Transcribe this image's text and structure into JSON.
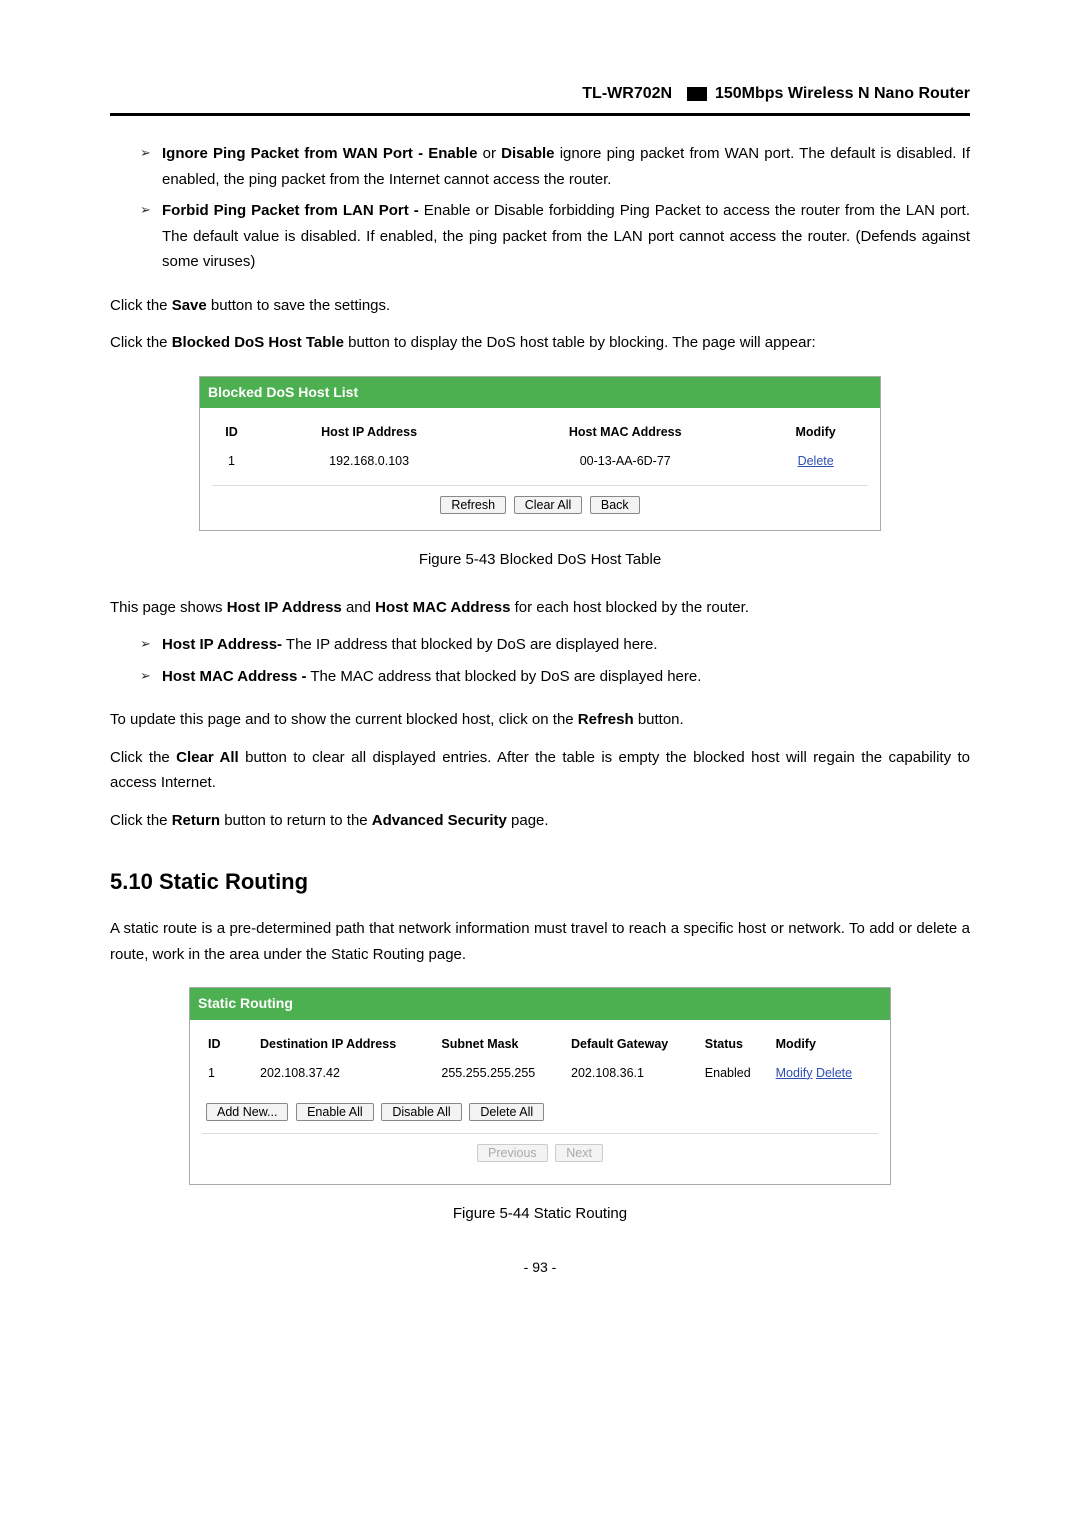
{
  "header": {
    "model": "TL-WR702N",
    "desc": "150Mbps Wireless N Nano Router"
  },
  "bullets_top": [
    {
      "bold": "Ignore Ping Packet from WAN Port - Enable",
      "mid": " or ",
      "bold2": "Disable",
      "rest": " ignore ping packet from WAN port. The default is disabled. If enabled, the ping packet from the Internet cannot access the router."
    },
    {
      "bold": "Forbid Ping Packet from LAN Port -",
      "rest": " Enable or Disable forbidding Ping Packet to access the router from the LAN port. The default value is disabled. If enabled, the ping packet from the LAN port cannot access the router. (Defends against some viruses)"
    }
  ],
  "para_save": {
    "pre": "Click the ",
    "bold": "Save",
    "post": " button to save the settings."
  },
  "para_blocked": {
    "pre": "Click the ",
    "bold": "Blocked DoS Host Table",
    "post": " button to display the DoS host table by blocking. The page will appear:"
  },
  "fig1": {
    "title": "Blocked DoS Host List",
    "headers": {
      "id": "ID",
      "ip": "Host IP Address",
      "mac": "Host MAC Address",
      "mod": "Modify"
    },
    "row": {
      "id": "1",
      "ip": "192.168.0.103",
      "mac": "00-13-AA-6D-77",
      "mod": "Delete"
    },
    "buttons": {
      "refresh": "Refresh",
      "clear": "Clear All",
      "back": "Back"
    },
    "caption": "Figure 5-43 Blocked DoS Host Table"
  },
  "para_shows": {
    "pre": "This page shows ",
    "b1": "Host IP Address",
    "mid": " and ",
    "b2": "Host MAC Address",
    "post": " for each host blocked by the router."
  },
  "bullets_mid": [
    {
      "bold": "Host IP Address-",
      "rest": " The IP address that blocked by DoS are displayed here."
    },
    {
      "bold": "Host MAC Address -",
      "rest": " The MAC address that blocked by DoS are displayed here."
    }
  ],
  "para_refresh": {
    "pre": "To update this page and to show the current blocked host, click on the ",
    "bold": "Refresh",
    "post": " button."
  },
  "para_clear": {
    "pre": "Click the ",
    "bold": "Clear All",
    "post": " button to clear all displayed entries. After the table is empty the blocked host will regain the capability to access Internet."
  },
  "para_return": {
    "pre": "Click the ",
    "bold": "Return",
    "mid": " button to return to the ",
    "bold2": "Advanced Security",
    "post": " page."
  },
  "section": {
    "num": "5.10",
    "title": "Static Routing"
  },
  "para_static": "A static route is a pre-determined path that network information must travel to reach a specific host or network. To add or delete a route, work in the area under the Static Routing page.",
  "fig2": {
    "title": "Static Routing",
    "headers": {
      "id": "ID",
      "dest": "Destination IP Address",
      "mask": "Subnet Mask",
      "gw": "Default Gateway",
      "status": "Status",
      "mod": "Modify"
    },
    "row": {
      "id": "1",
      "dest": "202.108.37.42",
      "mask": "255.255.255.255",
      "gw": "202.108.36.1",
      "status": "Enabled",
      "mod1": "Modify",
      "mod2": "Delete"
    },
    "buttons": {
      "add": "Add New...",
      "enable": "Enable All",
      "disable": "Disable All",
      "delete": "Delete All"
    },
    "pager": {
      "prev": "Previous",
      "next": "Next"
    },
    "caption": "Figure 5-44 Static Routing"
  },
  "pagenum": "- 93 -"
}
